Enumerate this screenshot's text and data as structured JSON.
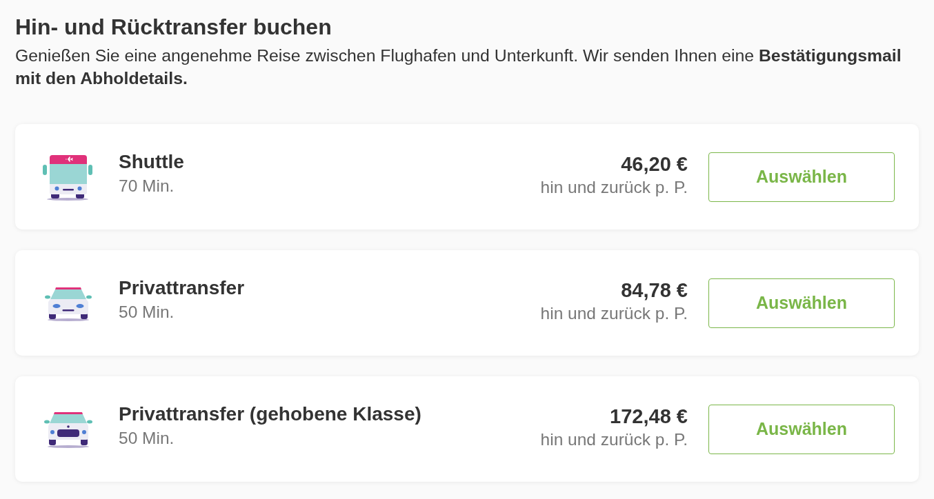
{
  "heading": "Hin- und Rücktransfer buchen",
  "intro": "Genießen Sie eine angenehme Reise zwischen Flughafen und Unterkunft. Wir senden Ihnen eine **Bestätigungsmail mit den Abholdetails.**",
  "options": [
    {
      "kind": "bus",
      "name": "Shuttle",
      "duration": "70 Min.",
      "price": "46,20 €",
      "price_note": "hin und zurück p. P.",
      "button": "Auswählen"
    },
    {
      "kind": "car",
      "name": "Privattransfer",
      "duration": "50 Min.",
      "price": "84,78 €",
      "price_note": "hin und zurück p. P.",
      "button": "Auswählen"
    },
    {
      "kind": "premium_car",
      "name": "Privattransfer (gehobene Klasse)",
      "duration": "50 Min.",
      "price": "172,48 €",
      "price_note": "hin und zurück p. P.",
      "button": "Auswählen"
    }
  ]
}
